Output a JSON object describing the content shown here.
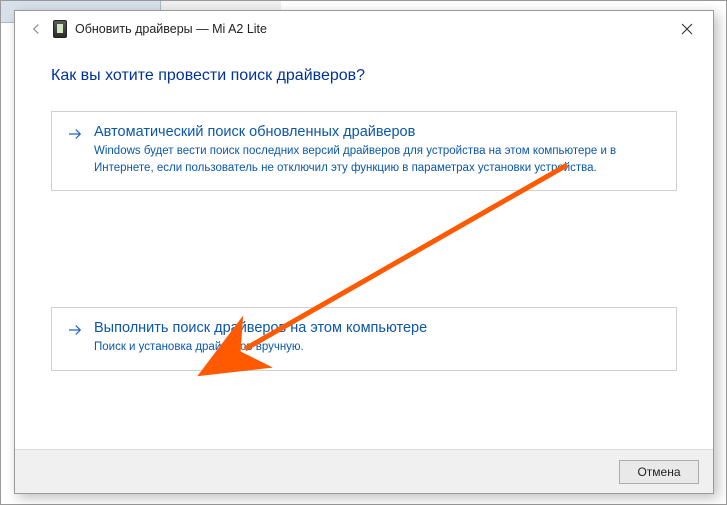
{
  "window": {
    "title_prefix": "Обновить драйверы",
    "title_sep": " — ",
    "device_name": "Mi A2 Lite"
  },
  "heading": "Как вы хотите провести поиск драйверов?",
  "options": [
    {
      "title": "Автоматический поиск обновленных драйверов",
      "description": "Windows будет вести поиск последних версий драйверов для устройства на этом компьютере и в Интернете, если пользователь не отключил эту функцию в параметрах установки устройства."
    },
    {
      "title": "Выполнить поиск драйверов на этом компьютере",
      "description": "Поиск и установка драйверов вручную."
    }
  ],
  "buttons": {
    "cancel": "Отмена"
  }
}
